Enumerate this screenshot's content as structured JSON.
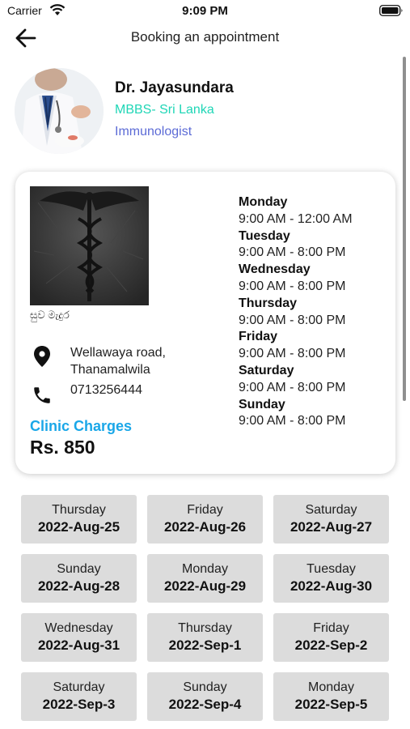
{
  "status_bar": {
    "carrier": "Carrier",
    "time": "9:09 PM"
  },
  "nav": {
    "title": "Booking an appointment"
  },
  "doctor": {
    "name": "Dr. Jayasundara",
    "qualification": "MBBS- Sri Lanka",
    "specialty": "Immunologist"
  },
  "clinic": {
    "name": "සුව මැදුර",
    "address_line1": "Wellawaya road,",
    "address_line2": "Thanamalwila",
    "phone": "0713256444",
    "charges_label": "Clinic Charges",
    "charges_value": "Rs. 850",
    "schedule": [
      {
        "day": "Monday",
        "time": "9:00 AM - 12:00 AM"
      },
      {
        "day": "Tuesday",
        "time": "9:00 AM - 8:00 PM"
      },
      {
        "day": "Wednesday",
        "time": "9:00 AM - 8:00 PM"
      },
      {
        "day": "Thursday",
        "time": "9:00 AM - 8:00 PM"
      },
      {
        "day": "Friday",
        "time": "9:00 AM - 8:00 PM"
      },
      {
        "day": "Saturday",
        "time": "9:00 AM - 8:00 PM"
      },
      {
        "day": "Sunday",
        "time": "9:00 AM - 8:00 PM"
      }
    ]
  },
  "dates": [
    {
      "day": "Thursday",
      "date": "2022-Aug-25"
    },
    {
      "day": "Friday",
      "date": "2022-Aug-26"
    },
    {
      "day": "Saturday",
      "date": "2022-Aug-27"
    },
    {
      "day": "Sunday",
      "date": "2022-Aug-28"
    },
    {
      "day": "Monday",
      "date": "2022-Aug-29"
    },
    {
      "day": "Tuesday",
      "date": "2022-Aug-30"
    },
    {
      "day": "Wednesday",
      "date": "2022-Aug-31"
    },
    {
      "day": "Thursday",
      "date": "2022-Sep-1"
    },
    {
      "day": "Friday",
      "date": "2022-Sep-2"
    },
    {
      "day": "Saturday",
      "date": "2022-Sep-3"
    },
    {
      "day": "Sunday",
      "date": "2022-Sep-4"
    },
    {
      "day": "Monday",
      "date": "2022-Sep-5"
    }
  ],
  "icons": {
    "back": "back-arrow-icon",
    "location": "location-pin-icon",
    "phone": "phone-icon",
    "wifi": "wifi-icon",
    "battery": "battery-icon"
  },
  "colors": {
    "qualification": "#1fd6b6",
    "specialty": "#5c6bd6",
    "charges_label": "#1aa7e8",
    "date_button_bg": "#dcdcdc"
  }
}
